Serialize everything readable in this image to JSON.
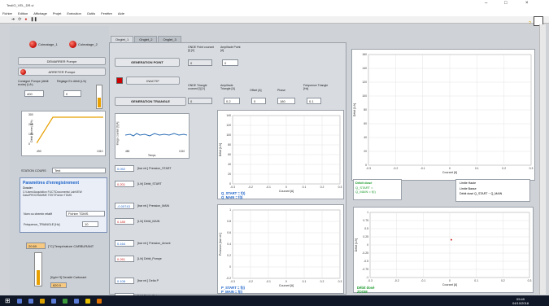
{
  "window": {
    "title": "TestIO_VEL_DR.vi",
    "minimize": "–",
    "maximize": "□",
    "close": "×"
  },
  "menu": [
    "Fichier",
    "Edition",
    "Affichage",
    "Projet",
    "Exécution",
    "Outils",
    "Fenêtre",
    "Aide"
  ],
  "toolbar": {
    "icons": [
      "run-arrow-icon",
      "run-continuous-icon",
      "abort-icon",
      "pause-icon"
    ],
    "help": "?"
  },
  "left": {
    "led1": "Colmatage_1",
    "led2": "Colmatage_2",
    "btn_start": "DEMARRER Pompe",
    "btn_stop": "ARRETER Pompe",
    "consigne_label": "Consigne Pompe (débit écrire) (L/h)",
    "consigne_value": "400",
    "reglage_label": "Réglage En débit (L/h)",
    "reglage_value": "0",
    "graph_ylabel": "Débit (écrire) (L/h)",
    "graph_yticks": [
      "300",
      "200",
      "100",
      "0"
    ],
    "graph_xticks": [
      "490",
      "1310"
    ],
    "station_label": "STATION COURS",
    "station_value": "Test",
    "params_title": "Paramètres d'enregistrement",
    "params_sub": "Dossier",
    "params_path": "C:\\Users\\Acquisition FUCT\\Documents\\ LabVIEW Data\\PROGRAMME TEST\\Fichier TDMS",
    "nom_label": "Nom ou chemin relatif",
    "nom_value": "Fichier TDMS",
    "freq_label": "Fréquence_TRIANGLE [Hz]",
    "freq_value": "10",
    "temp_value": "20.60",
    "temp_label": "[°C] Température CARBURANT",
    "densite_value": "820.0",
    "densite_label": "[Kg/m^3] Densité Carburant"
  },
  "tabs": [
    "Onglet_1",
    "Onglet_2",
    "Onglet_3"
  ],
  "mid": {
    "gen_point": "GENERATION POINT",
    "onde_point": "ONDE Point courant [I] [V]",
    "onde_point_val": "0",
    "ampl_point": "Amplitude Point [A]",
    "ampl_point_val": "0",
    "inactif": "INACTIF",
    "onde_tri": "ONDE Triangle courant [I] [V]",
    "onde_tri_val": "0",
    "gen_tri": "GENERATION TRIANGLE",
    "ampl_tri": "Amplitude Triangle [A]",
    "ampl_tri_val": "0.2",
    "offset": "Offset [A]",
    "offset_val": "0",
    "phase": "Phase",
    "phase_val": "180",
    "freq_tri": "Fréquence Triangle [Hz]",
    "freq_tri_val": "0.1",
    "small_graph_xlabel": "Temps",
    "small_graph_ylabel": "Image courant [I] [A]",
    "small_graph_xticks": [
      "480",
      "1310"
    ],
    "readings": [
      {
        "v": "0.052",
        "l": "[bar rel.] Pression_START"
      },
      {
        "v": "0.201",
        "l": "[L/h] Débit_START"
      },
      {
        "v": "-0.00743",
        "l": "[bar rel.] Pression_MAIN"
      },
      {
        "v": "0.185",
        "l": "[L/h] Débit_MAIN"
      },
      {
        "v": "0.164",
        "l": "[bar rel.] Pression_Amont"
      },
      {
        "v": "0.261",
        "l": "[L/h] Débit_Pompe"
      },
      {
        "v": "0.108",
        "l": "[bar rel.] Delta P"
      },
      {
        "v": "0.182",
        "l": "[L/h] Débit_Retour pompe"
      }
    ],
    "graph1": {
      "ylabel": "Débit [L/h]",
      "xlabel": "Courant [A]",
      "yticks": [
        "140",
        "120",
        "100",
        "80",
        "60",
        "40",
        "20",
        "0"
      ],
      "xticks": [
        "-0.3",
        "-0.2",
        "-0.1",
        "0",
        "0.1",
        "0.2",
        "0.3"
      ],
      "legend": [
        "Q_START = f(I)",
        "Q_MAIN = f(I)"
      ]
    },
    "graph2": {
      "ylabel": "Pression [bar rel.]",
      "xlabel": "Courant [A]",
      "yticks": [
        "1",
        "0.8",
        "0.6",
        "0.4",
        "0.2",
        "0",
        "-0.2"
      ],
      "xticks": [
        "-0.3",
        "-0.2",
        "-0.1",
        "0",
        "0.1",
        "0.2",
        "0.3"
      ],
      "legend": [
        "P_START = f(I)",
        "P_MAIN = f(I)"
      ]
    }
  },
  "right": {
    "graph1": {
      "ylabel": "Débit [L/h]",
      "xlabel": "Courant [A]",
      "yticks": [
        "160",
        "140",
        "120",
        "100",
        "80",
        "60",
        "40",
        "20",
        "0"
      ],
      "xticks": [
        "-0.3",
        "-0.2",
        "-0.1",
        "0",
        "0.1",
        "0.2",
        "0.3"
      ]
    },
    "legend_title": "Débit dosé",
    "legend_q": [
      "Q_START =",
      "Q_MAIN = f(I)"
    ],
    "limits": [
      "Limite Haute",
      "Limite Basse",
      "Débit dosé Q_START − Q_MAIN"
    ],
    "graph2": {
      "ylabel": "Débit [L/h]",
      "xlabel": "Courant [A]",
      "yticks": [
        "1",
        "0.75",
        "0.5",
        "0.25",
        "0",
        "-0.25",
        "-0.5",
        "-0.75",
        "-1"
      ],
      "xticks": [
        "-0.3",
        "-0.2",
        "-0.1",
        "0",
        "0.1",
        "0.2",
        "0.3"
      ],
      "legend": [
        "Débit dosé",
        "ZOOM"
      ]
    }
  },
  "taskbar": {
    "time": "09:49",
    "date": "04/10/2018"
  }
}
